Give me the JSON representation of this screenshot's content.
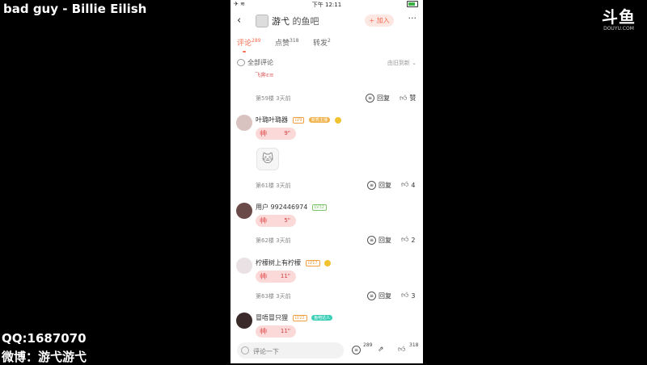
{
  "overlay": {
    "song": "bad guy - Billie Eilish",
    "qq": "QQ:1687070",
    "weibo": "微博：游弋游弋",
    "logo_main": "斗鱼",
    "logo_sub": "DOUYU.COM"
  },
  "status_bar": {
    "time": "下午 12:11"
  },
  "nav": {
    "title": "游弋",
    "title_suffix": "的鱼吧",
    "join_label": "+ 加入"
  },
  "tabs": [
    {
      "label": "评论",
      "count": "289"
    },
    {
      "label": "点赞",
      "count": "318"
    },
    {
      "label": "转发",
      "count": "2"
    }
  ],
  "comments_header": {
    "label": "全部评论",
    "sort": "由旧到新"
  },
  "fragment_text": "飞奔ε≡",
  "first_meta": "第59楼  3天前",
  "reply_label": "回复",
  "like_label": "赞",
  "comments": [
    {
      "user": "叶璐叶璐器",
      "level": "LV9",
      "badge": "新秀主播",
      "duration": "9\"",
      "meta": "第61楼  3天前",
      "likes": "4"
    },
    {
      "user": "用户 992446974",
      "level": "LV32",
      "badge": "",
      "duration": "5\"",
      "meta": "第62楼  3天前",
      "likes": "2"
    },
    {
      "user": "柠檬树上有柠檬",
      "level": "LV17",
      "badge": "",
      "duration": "11\"",
      "meta": "第63楼  3天前",
      "likes": "3"
    },
    {
      "user": "冒唔冒只狸",
      "level": "LV22",
      "badge": "鱼吧达人",
      "duration": "11\"",
      "meta": "",
      "likes": ""
    }
  ],
  "bottom_bar": {
    "placeholder": "评论一下",
    "comment_count": "289",
    "like_count": "318"
  }
}
